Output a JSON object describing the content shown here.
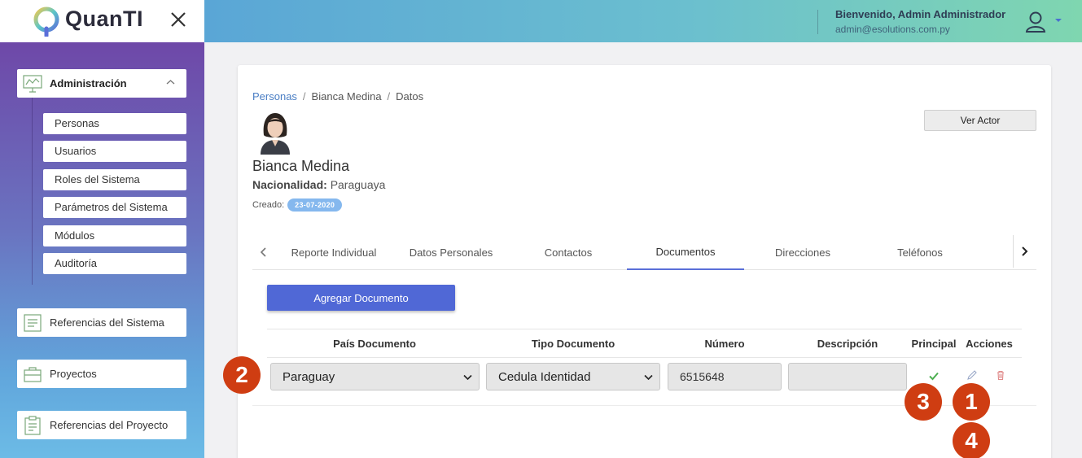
{
  "app": {
    "logo_text": "QuanTI"
  },
  "header": {
    "welcome": "Bienvenido, Admin Administrador",
    "email": "admin@esolutions.com.py"
  },
  "sidebar": {
    "admin_label": "Administración",
    "sub_items": [
      "Personas",
      "Usuarios",
      "Roles del Sistema",
      "Parámetros del Sistema",
      "Módulos",
      "Auditoría"
    ],
    "sections": [
      "Referencias del Sistema",
      "Proyectos",
      "Referencias del Proyecto"
    ]
  },
  "breadcrumb": [
    "Personas",
    "Bianca Medina",
    "Datos"
  ],
  "person": {
    "name": "Bianca Medina",
    "nationality_label": "Nacionalidad:",
    "nationality": "Paraguaya",
    "created_label": "Creado:",
    "created_date": "23-07-2020"
  },
  "actions": {
    "ver_actor": "Ver Actor",
    "add_document": "Agregar Documento"
  },
  "tabs": [
    "Reporte Individual",
    "Datos Personales",
    "Contactos",
    "Documentos",
    "Direcciones",
    "Teléfonos"
  ],
  "active_tab": "Documentos",
  "table": {
    "headers": [
      "País Documento",
      "Tipo Documento",
      "Número",
      "Descripción",
      "Principal",
      "Acciones"
    ],
    "row": {
      "pais": "Paraguay",
      "tipo": "Cedula Identidad",
      "numero": "6515648",
      "descripcion": ""
    }
  },
  "markers": [
    "1",
    "2",
    "3",
    "4"
  ],
  "colors": {
    "accent": "#5068d6",
    "marker": "#cf3d12",
    "badge": "#85b8ee"
  }
}
